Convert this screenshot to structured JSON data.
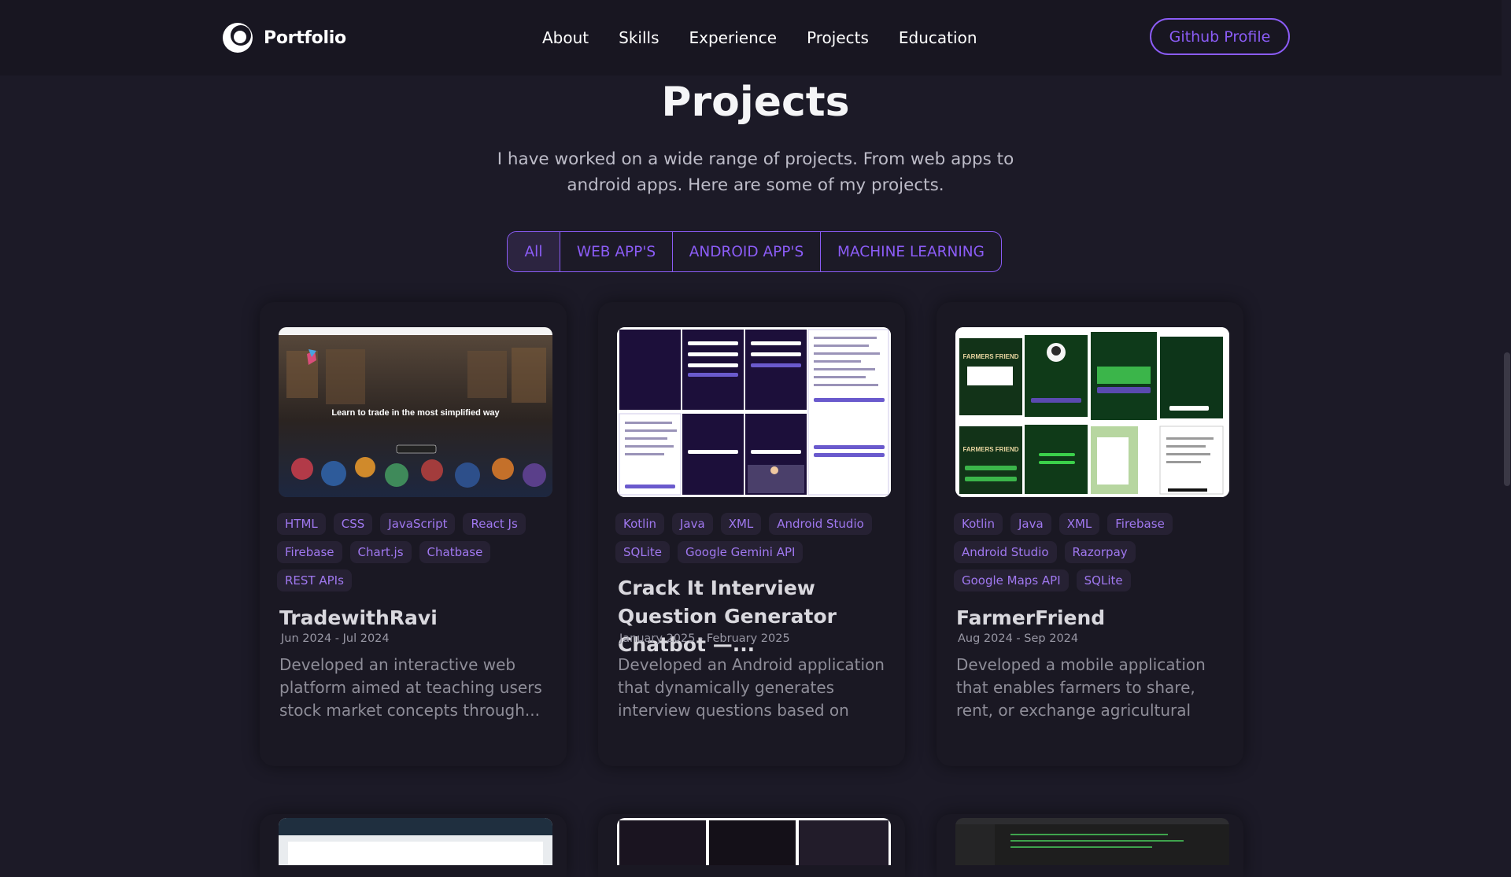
{
  "header": {
    "logo_text": "Portfolio",
    "nav": [
      "About",
      "Skills",
      "Experience",
      "Projects",
      "Education"
    ],
    "github_label": "Github Profile"
  },
  "section": {
    "title": "Projects",
    "subtitle": "I have worked on a wide range of projects. From web apps to android apps. Here are some of my projects."
  },
  "filters": [
    {
      "label": "All",
      "active": true
    },
    {
      "label": "WEB APP'S",
      "active": false
    },
    {
      "label": "ANDROID APP'S",
      "active": false
    },
    {
      "label": "MACHINE LEARNING",
      "active": false
    }
  ],
  "projects": [
    {
      "title": "TradewithRavi",
      "date": "Jun 2024 - Jul 2024",
      "description": "Developed an interactive web platform aimed at teaching users stock market concepts through...",
      "tags": [
        "HTML",
        "CSS",
        "JavaScript",
        "React Js",
        "Firebase",
        "Chart.js",
        "Chatbase",
        "REST APIs"
      ],
      "image_text": "Learn to trade in the most simplified way"
    },
    {
      "title": "Crack It Interview Question Generator Chatbot —...",
      "date": "January 2025 - February 2025",
      "description": "Developed an Android application that dynamically generates interview questions based on any...",
      "tags": [
        "Kotlin",
        "Java",
        "XML",
        "Android Studio",
        "SQLite",
        "Google Gemini API"
      ]
    },
    {
      "title": "FarmerFriend",
      "date": "Aug 2024 - Sep 2024",
      "description": "Developed a mobile application that enables farmers to share, rent, or exchange agricultural tools and...",
      "tags": [
        "Kotlin",
        "Java",
        "XML",
        "Firebase",
        "Android Studio",
        "Razorpay",
        "Google Maps API",
        "SQLite"
      ],
      "image_text": "FARMERS FRIEND"
    }
  ],
  "colors": {
    "accent": "#8b5cf6",
    "background": "#1c1a27",
    "card": "#1a1823"
  }
}
